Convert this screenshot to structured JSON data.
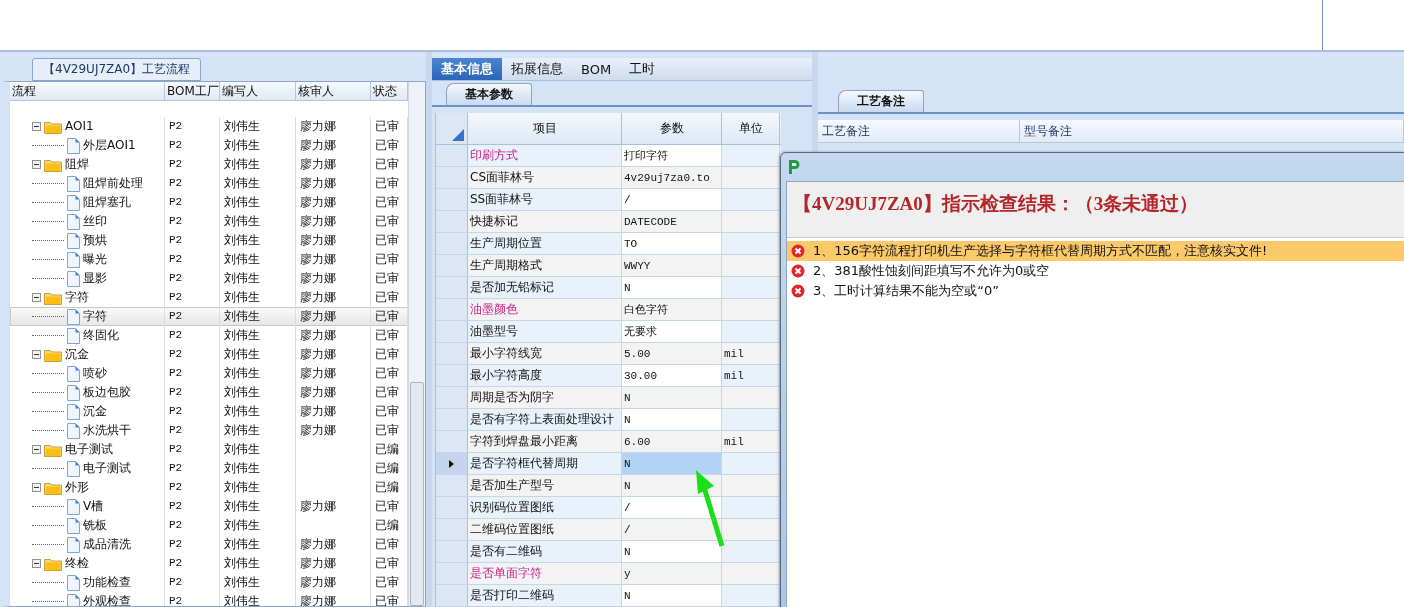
{
  "flow_panel": {
    "title": "【4V29UJ7ZA0】工艺流程",
    "columns": [
      "流程",
      "BOM工厂",
      "编写人",
      "核审人",
      "状态"
    ],
    "tree": [
      {
        "name": "AOI1",
        "factory": "P2",
        "writer": "刘伟生",
        "reviewer": "廖力娜",
        "status": "已审",
        "selected": false,
        "children": [
          {
            "name": "外层AOI1",
            "factory": "P2",
            "writer": "刘伟生",
            "reviewer": "廖力娜",
            "status": "已审",
            "selected": false
          }
        ]
      },
      {
        "name": "阻焊",
        "factory": "P2",
        "writer": "刘伟生",
        "reviewer": "廖力娜",
        "status": "已审",
        "selected": false,
        "children": [
          {
            "name": "阻焊前处理",
            "factory": "P2",
            "writer": "刘伟生",
            "reviewer": "廖力娜",
            "status": "已审",
            "selected": false
          },
          {
            "name": "阻焊塞孔",
            "factory": "P2",
            "writer": "刘伟生",
            "reviewer": "廖力娜",
            "status": "已审",
            "selected": false
          },
          {
            "name": "丝印",
            "factory": "P2",
            "writer": "刘伟生",
            "reviewer": "廖力娜",
            "status": "已审",
            "selected": false
          },
          {
            "name": "预烘",
            "factory": "P2",
            "writer": "刘伟生",
            "reviewer": "廖力娜",
            "status": "已审",
            "selected": false
          },
          {
            "name": "曝光",
            "factory": "P2",
            "writer": "刘伟生",
            "reviewer": "廖力娜",
            "status": "已审",
            "selected": false
          },
          {
            "name": "显影",
            "factory": "P2",
            "writer": "刘伟生",
            "reviewer": "廖力娜",
            "status": "已审",
            "selected": false
          }
        ]
      },
      {
        "name": "字符",
        "factory": "P2",
        "writer": "刘伟生",
        "reviewer": "廖力娜",
        "status": "已审",
        "selected": false,
        "children": [
          {
            "name": "字符",
            "factory": "P2",
            "writer": "刘伟生",
            "reviewer": "廖力娜",
            "status": "已审",
            "selected": true
          },
          {
            "name": "终固化",
            "factory": "P2",
            "writer": "刘伟生",
            "reviewer": "廖力娜",
            "status": "已审",
            "selected": false
          }
        ]
      },
      {
        "name": "沉金",
        "factory": "P2",
        "writer": "刘伟生",
        "reviewer": "廖力娜",
        "status": "已审",
        "selected": false,
        "children": [
          {
            "name": "喷砂",
            "factory": "P2",
            "writer": "刘伟生",
            "reviewer": "廖力娜",
            "status": "已审",
            "selected": false
          },
          {
            "name": "板边包胶",
            "factory": "P2",
            "writer": "刘伟生",
            "reviewer": "廖力娜",
            "status": "已审",
            "selected": false
          },
          {
            "name": "沉金",
            "factory": "P2",
            "writer": "刘伟生",
            "reviewer": "廖力娜",
            "status": "已审",
            "selected": false
          },
          {
            "name": "水洗烘干",
            "factory": "P2",
            "writer": "刘伟生",
            "reviewer": "廖力娜",
            "status": "已审",
            "selected": false
          }
        ]
      },
      {
        "name": "电子测试",
        "factory": "P2",
        "writer": "刘伟生",
        "status": "已编",
        "selected": false,
        "children": [
          {
            "name": "电子测试",
            "factory": "P2",
            "writer": "刘伟生",
            "status": "已编",
            "selected": false
          }
        ]
      },
      {
        "name": "外形",
        "factory": "P2",
        "writer": "刘伟生",
        "status": "已编",
        "selected": false,
        "children": [
          {
            "name": "V槽",
            "factory": "P2",
            "writer": "刘伟生",
            "reviewer": "廖力娜",
            "status": "已审",
            "selected": false
          },
          {
            "name": "铣板",
            "factory": "P2",
            "writer": "刘伟生",
            "status": "已编",
            "selected": false
          },
          {
            "name": "成品清洗",
            "factory": "P2",
            "writer": "刘伟生",
            "reviewer": "廖力娜",
            "status": "已审",
            "selected": false
          }
        ]
      },
      {
        "name": "终检",
        "factory": "P2",
        "writer": "刘伟生",
        "reviewer": "廖力娜",
        "status": "已审",
        "selected": false,
        "children": [
          {
            "name": "功能检查",
            "factory": "P2",
            "writer": "刘伟生",
            "reviewer": "廖力娜",
            "status": "已审",
            "selected": false
          },
          {
            "name": "外观检查",
            "factory": "P2",
            "writer": "刘伟生",
            "reviewer": "廖力娜",
            "status": "已审",
            "selected": false
          }
        ]
      }
    ]
  },
  "info_panel": {
    "tabs": [
      {
        "label": "基本信息",
        "selected": true
      },
      {
        "label": "拓展信息",
        "selected": false
      },
      {
        "label": "BOM",
        "selected": false
      },
      {
        "label": "工时",
        "selected": false
      }
    ],
    "sub_tab": "基本参数",
    "columns": [
      "项目",
      "参数",
      "单位"
    ],
    "rows": [
      {
        "item": "印刷方式",
        "value": "打印字符",
        "required": true,
        "selected": false
      },
      {
        "item": "CS面菲林号",
        "value": "4v29uj7za0.to",
        "required": false,
        "selected": false
      },
      {
        "item": "SS面菲林号",
        "value": "/",
        "required": false,
        "selected": false
      },
      {
        "item": "快捷标记",
        "value": "DATECODE",
        "required": false,
        "selected": false
      },
      {
        "item": "生产周期位置",
        "value": "TO",
        "required": false,
        "selected": false
      },
      {
        "item": "生产周期格式",
        "value": "WWYY",
        "required": false,
        "selected": false
      },
      {
        "item": "是否加无铅标记",
        "value": "N",
        "required": false,
        "selected": false
      },
      {
        "item": "油墨颜色",
        "value": "白色字符",
        "required": true,
        "selected": false
      },
      {
        "item": "油墨型号",
        "value": "无要求",
        "required": false,
        "selected": false
      },
      {
        "item": "最小字符线宽",
        "value": "5.00",
        "unit": "mil",
        "required": false,
        "selected": false
      },
      {
        "item": "最小字符高度",
        "value": "30.00",
        "unit": "mil",
        "required": false,
        "selected": false
      },
      {
        "item": "周期是否为阴字",
        "value": "N",
        "required": false,
        "selected": false
      },
      {
        "item": "是否有字符上表面处理设计",
        "value": "N",
        "required": false,
        "selected": false
      },
      {
        "item": "字符到焊盘最小距离",
        "value": "6.00",
        "unit": "mil",
        "required": false,
        "selected": false
      },
      {
        "item": "是否字符框代替周期",
        "value": "N",
        "required": false,
        "selected": true
      },
      {
        "item": "是否加生产型号",
        "value": "N",
        "required": false,
        "selected": false
      },
      {
        "item": "识别码位置图纸",
        "value": "/",
        "required": false,
        "selected": false
      },
      {
        "item": "二维码位置图纸",
        "value": "/",
        "required": false,
        "selected": false
      },
      {
        "item": "是否有二维码",
        "value": "N",
        "required": false,
        "selected": false
      },
      {
        "item": "是否单面字符",
        "value": "y",
        "required": true,
        "selected": false
      },
      {
        "item": "是否打印二维码",
        "value": "N",
        "required": false,
        "selected": false
      }
    ]
  },
  "notes_panel": {
    "tab": "工艺备注",
    "columns": [
      "工艺备注",
      "型号备注"
    ]
  },
  "result_dialog": {
    "heading": "【4V29UJ7ZA0】指示检查结果：（3条未通过）",
    "items": [
      {
        "text": "1、156字符流程打印机生产选择与字符框代替周期方式不匹配，注意核实文件!",
        "selected": true
      },
      {
        "text": "2、381酸性蚀刻间距填写不允许为0或空",
        "selected": false
      },
      {
        "text": "3、工时计算结果不能为空或“0”",
        "selected": false
      }
    ]
  }
}
